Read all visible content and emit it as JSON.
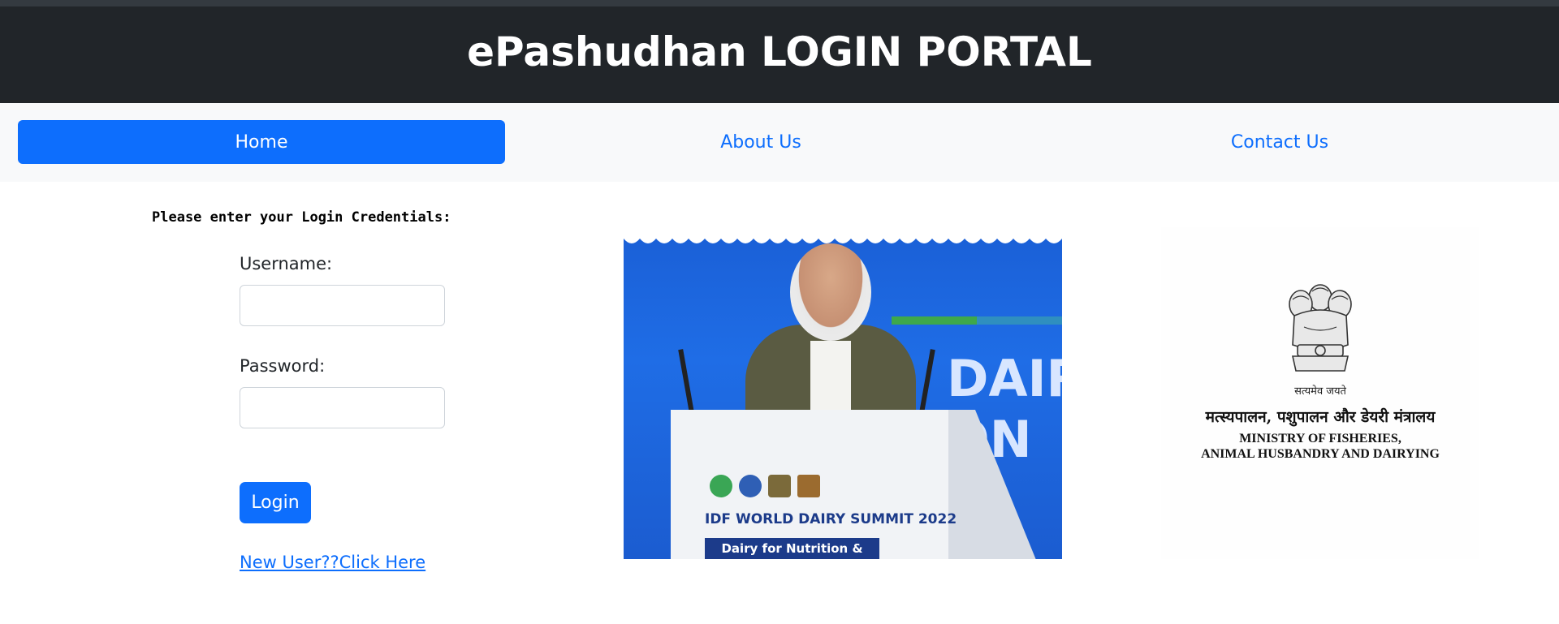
{
  "header": {
    "title": "ePashudhan LOGIN PORTAL"
  },
  "nav": {
    "items": [
      {
        "label": "Home",
        "active": true
      },
      {
        "label": "About Us",
        "active": false
      },
      {
        "label": "Contact Us",
        "active": false
      }
    ]
  },
  "login": {
    "prompt": "Please enter your Login Credentials:",
    "username_label": "Username:",
    "username_value": "",
    "password_label": "Password:",
    "password_value": "",
    "login_button": "Login",
    "register_link": "New User??Click Here"
  },
  "photo": {
    "banner_text_1": "DAIRY",
    "banner_text_2": "ON &",
    "podium_title": "IDF WORLD DAIRY SUMMIT 2022",
    "podium_subtitle": "Dairy for Nutrition & Livelihood"
  },
  "emblem": {
    "motto": "सत्यमेव जयते",
    "hindi_name": "मत्स्यपालन, पशुपालन और डेयरी मंत्रालय",
    "english_line_1": "MINISTRY OF FISHERIES,",
    "english_line_2": "ANIMAL HUSBANDRY AND DAIRYING"
  },
  "colors": {
    "header_bg": "#212529",
    "nav_bg": "#f8f9fa",
    "primary": "#0d6efd"
  }
}
